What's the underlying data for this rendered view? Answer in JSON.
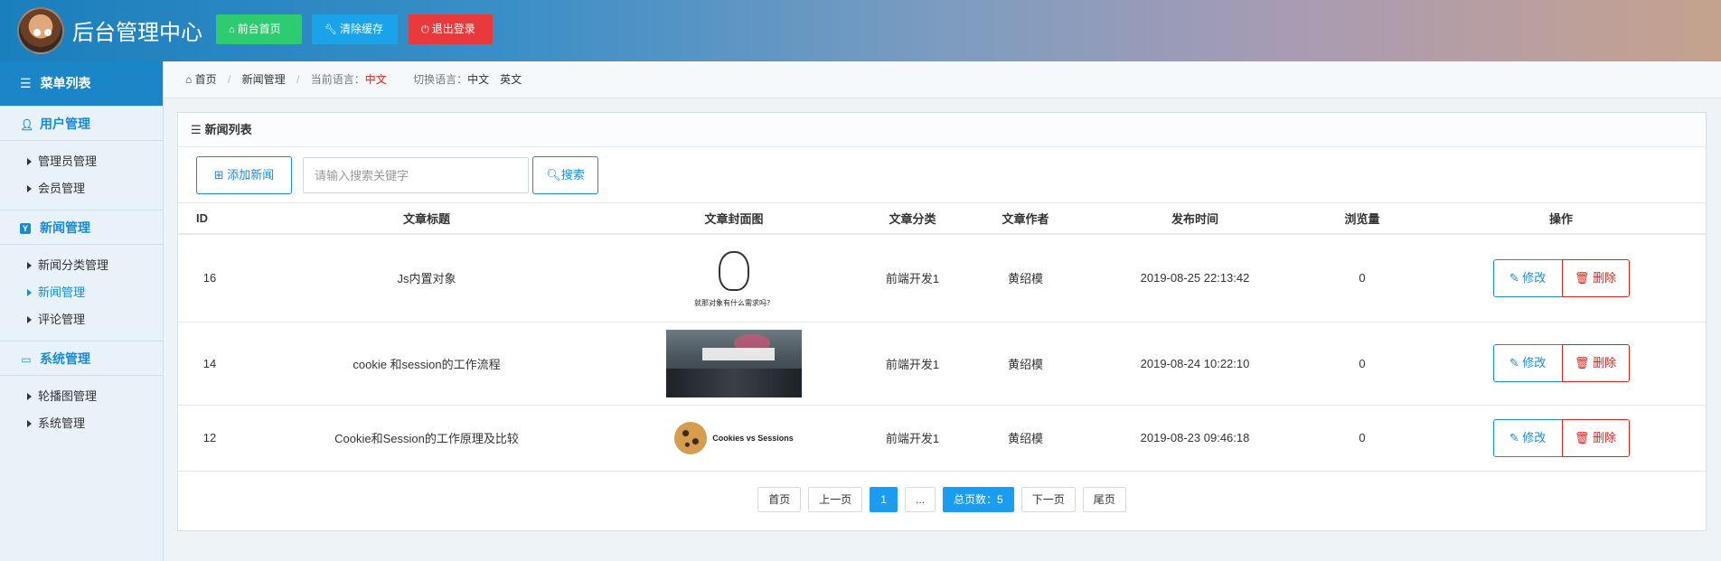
{
  "header": {
    "title": "后台管理中心",
    "buttons": {
      "home": "前台首页",
      "cache": "清除缓存",
      "logout": "退出登录"
    }
  },
  "sidebar": {
    "title": "菜单列表",
    "groups": [
      {
        "label": "用户管理",
        "items": [
          "管理员管理",
          "会员管理"
        ]
      },
      {
        "label": "新闻管理",
        "items": [
          "新闻分类管理",
          "新闻管理",
          "评论管理"
        ]
      },
      {
        "label": "系统管理",
        "items": [
          "轮播图管理",
          "系统管理"
        ]
      }
    ],
    "active_item": "新闻管理"
  },
  "breadcrumb": {
    "home": "首页",
    "section": "新闻管理",
    "current_lang_label": "当前语言：",
    "current_lang": "中文",
    "switch_label": "切换语言：",
    "lang_zh": "中文",
    "lang_en": "英文"
  },
  "panel": {
    "title": "新闻列表",
    "add_button": "添加新闻",
    "search_placeholder": "请输入搜索关键字",
    "search_button": "搜索",
    "columns": [
      "ID",
      "文章标题",
      "文章封面图",
      "文章分类",
      "文章作者",
      "发布时间",
      "浏览量",
      "操作"
    ],
    "rows": [
      {
        "id": "16",
        "title": "Js内置对象",
        "cover_caption": "就那对象有什么需求吗？",
        "category": "前端开发1",
        "author": "黄绍模",
        "time": "2019-08-25 22:13:42",
        "views": "0"
      },
      {
        "id": "14",
        "title": "cookie 和session的工作流程",
        "category": "前端开发1",
        "author": "黄绍模",
        "time": "2019-08-24 10:22:10",
        "views": "0"
      },
      {
        "id": "12",
        "title": "Cookie和Session的工作原理及比较",
        "cover_caption": "Cookies vs Sessions",
        "category": "前端开发1",
        "author": "黄绍模",
        "time": "2019-08-23 09:46:18",
        "views": "0"
      }
    ],
    "ops": {
      "edit": "修改",
      "delete": "删除"
    }
  },
  "pager": {
    "first": "首页",
    "prev": "上一页",
    "current": "1",
    "ellipsis": "...",
    "total": "总页数：5",
    "next": "下一页",
    "last": "尾页"
  },
  "colors": {
    "accent": "#1b8bd0",
    "danger": "#d9241c",
    "home_button": "#2ecc71",
    "cache_button": "#1aa3e8",
    "logout_button": "#e8393d"
  }
}
